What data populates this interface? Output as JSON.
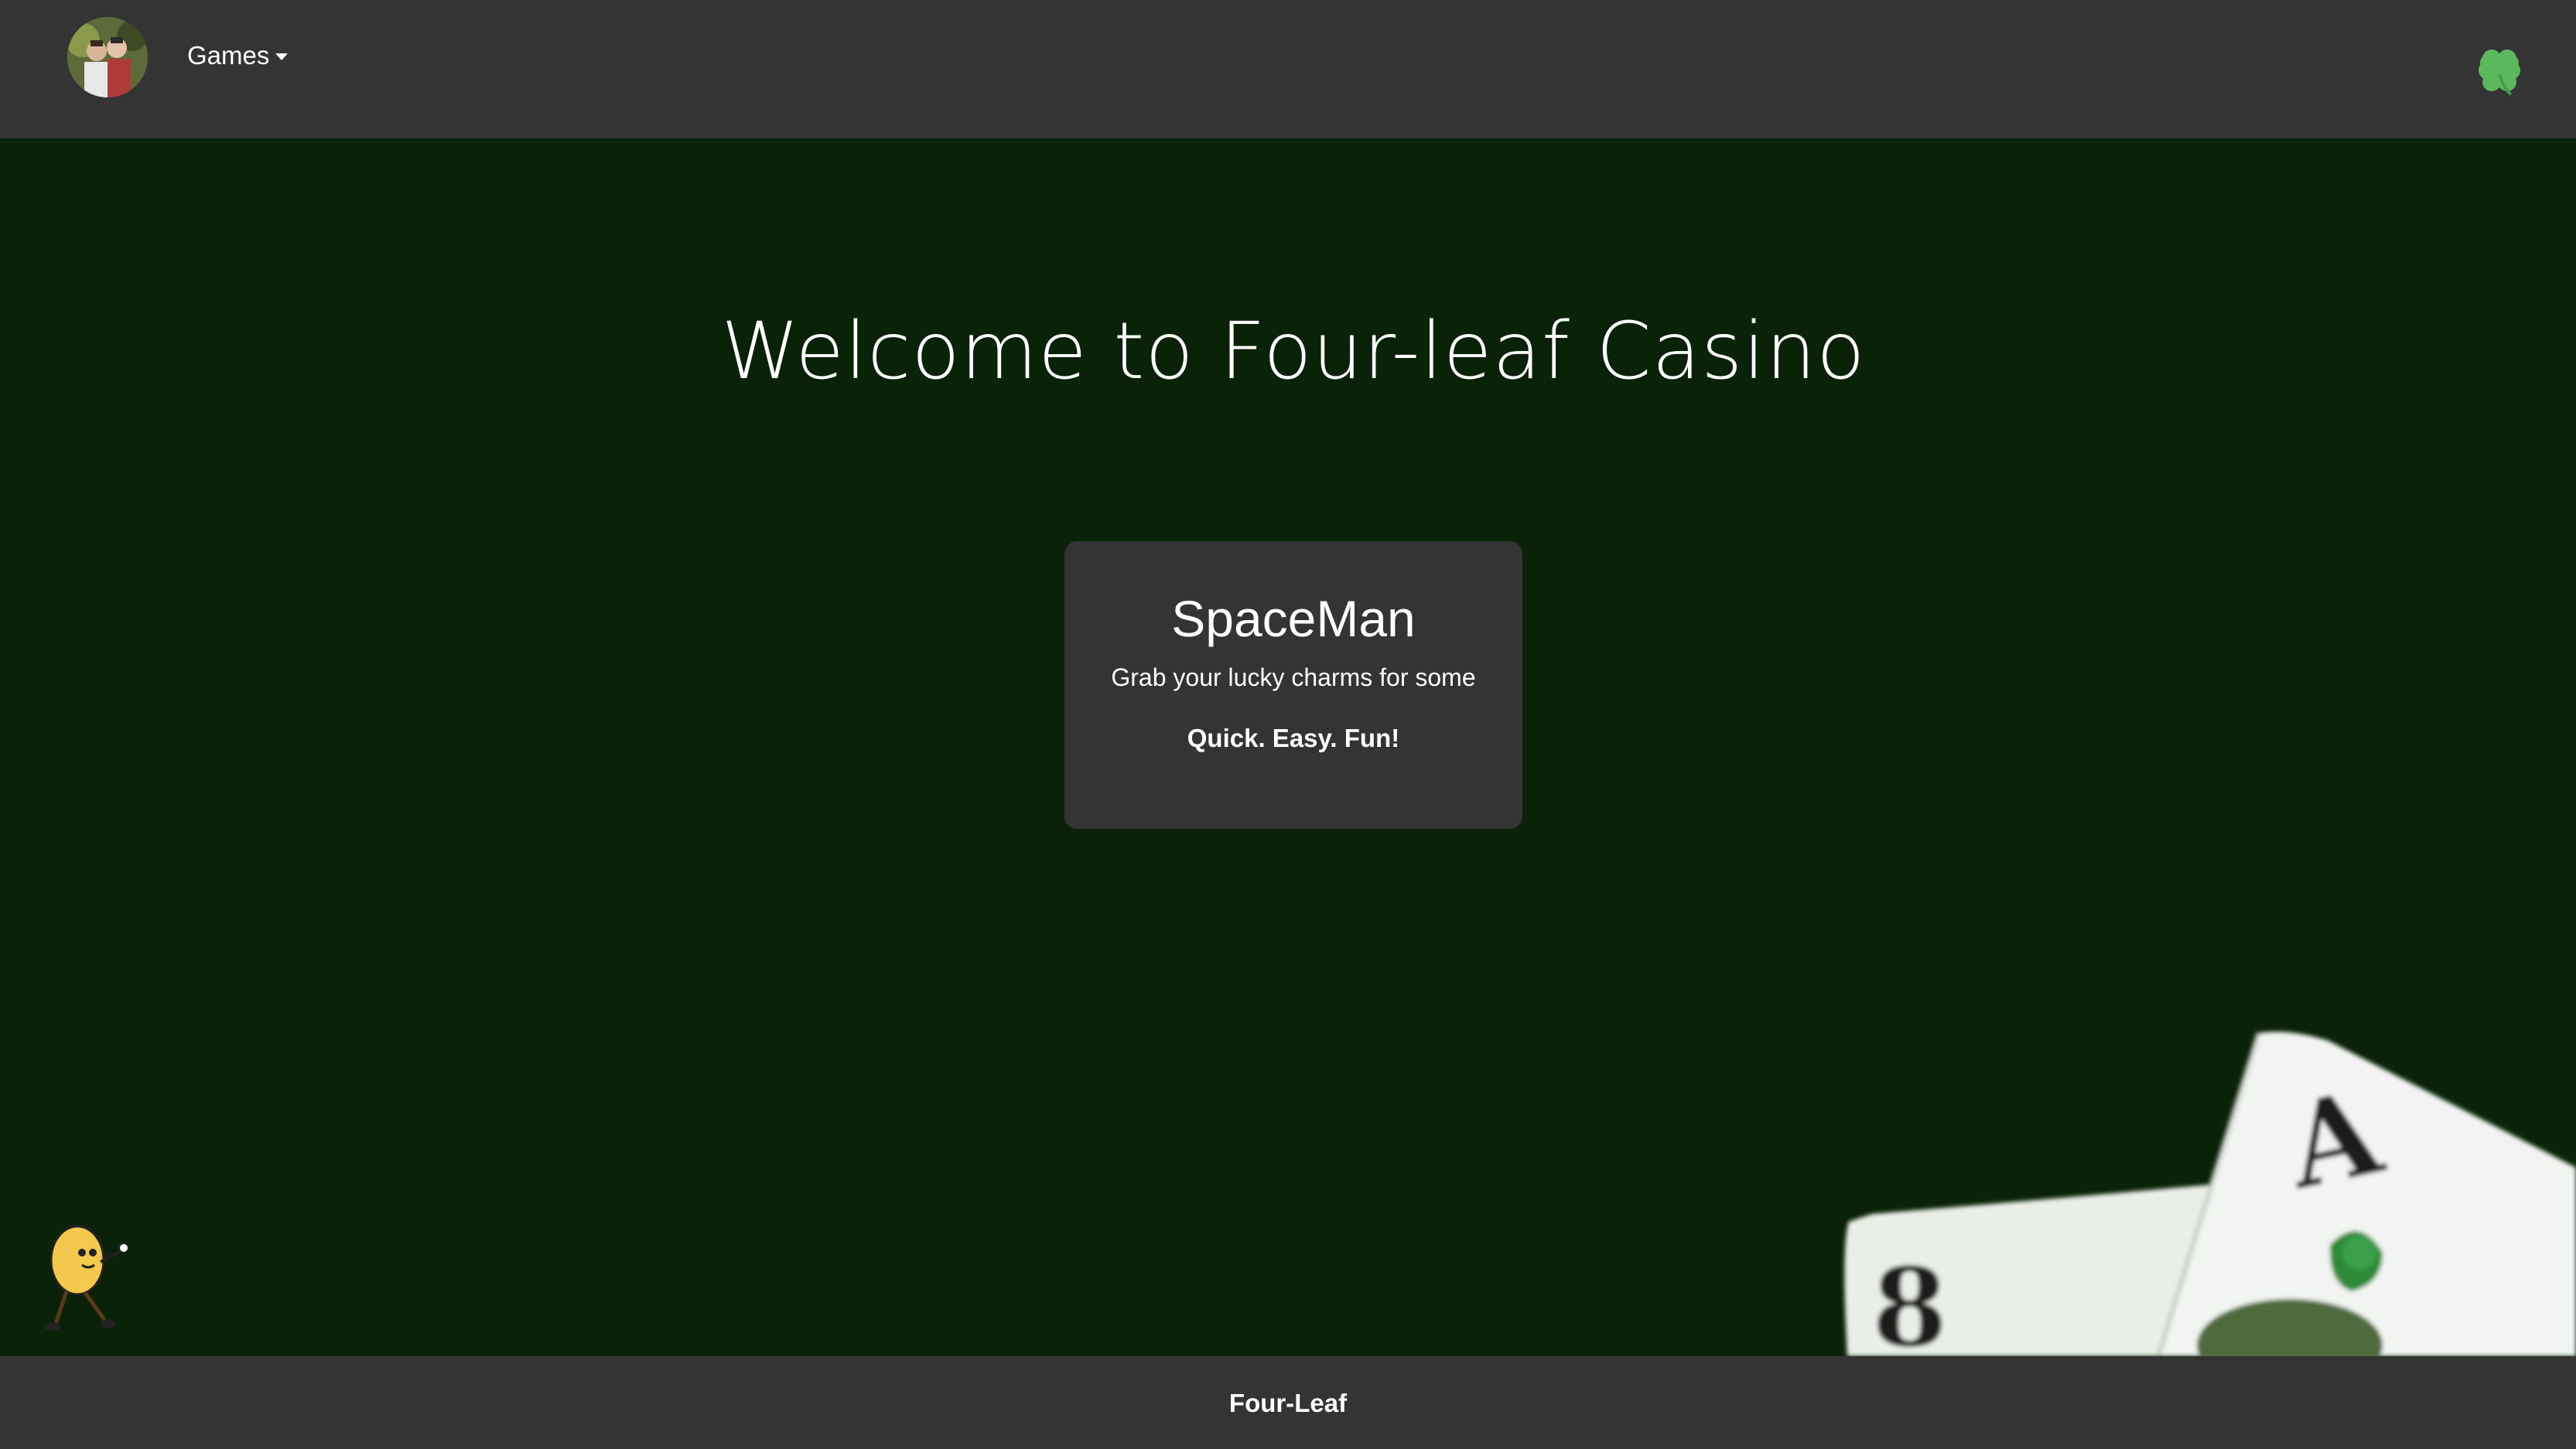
{
  "navbar": {
    "avatar_icon": "user-avatar-photo",
    "games_label": "Games",
    "clover_icon": "four-leaf-clover-icon",
    "clover_color": "#5cb85c"
  },
  "hero": {
    "title": "Welcome to Four-leaf Casino"
  },
  "game_card": {
    "title": "SpaceMan",
    "subtitle": "Grab your lucky charms for some",
    "tagline": "Quick. Easy. Fun!"
  },
  "decorations": {
    "mascot_icon": "peanut-mascot-icon",
    "cards_art": "playing-cards-art"
  },
  "footer": {
    "brand": "Four-Leaf"
  },
  "colors": {
    "background": "#0a2208",
    "bar": "#343434",
    "card": "#343434",
    "text": "#ffffff"
  }
}
